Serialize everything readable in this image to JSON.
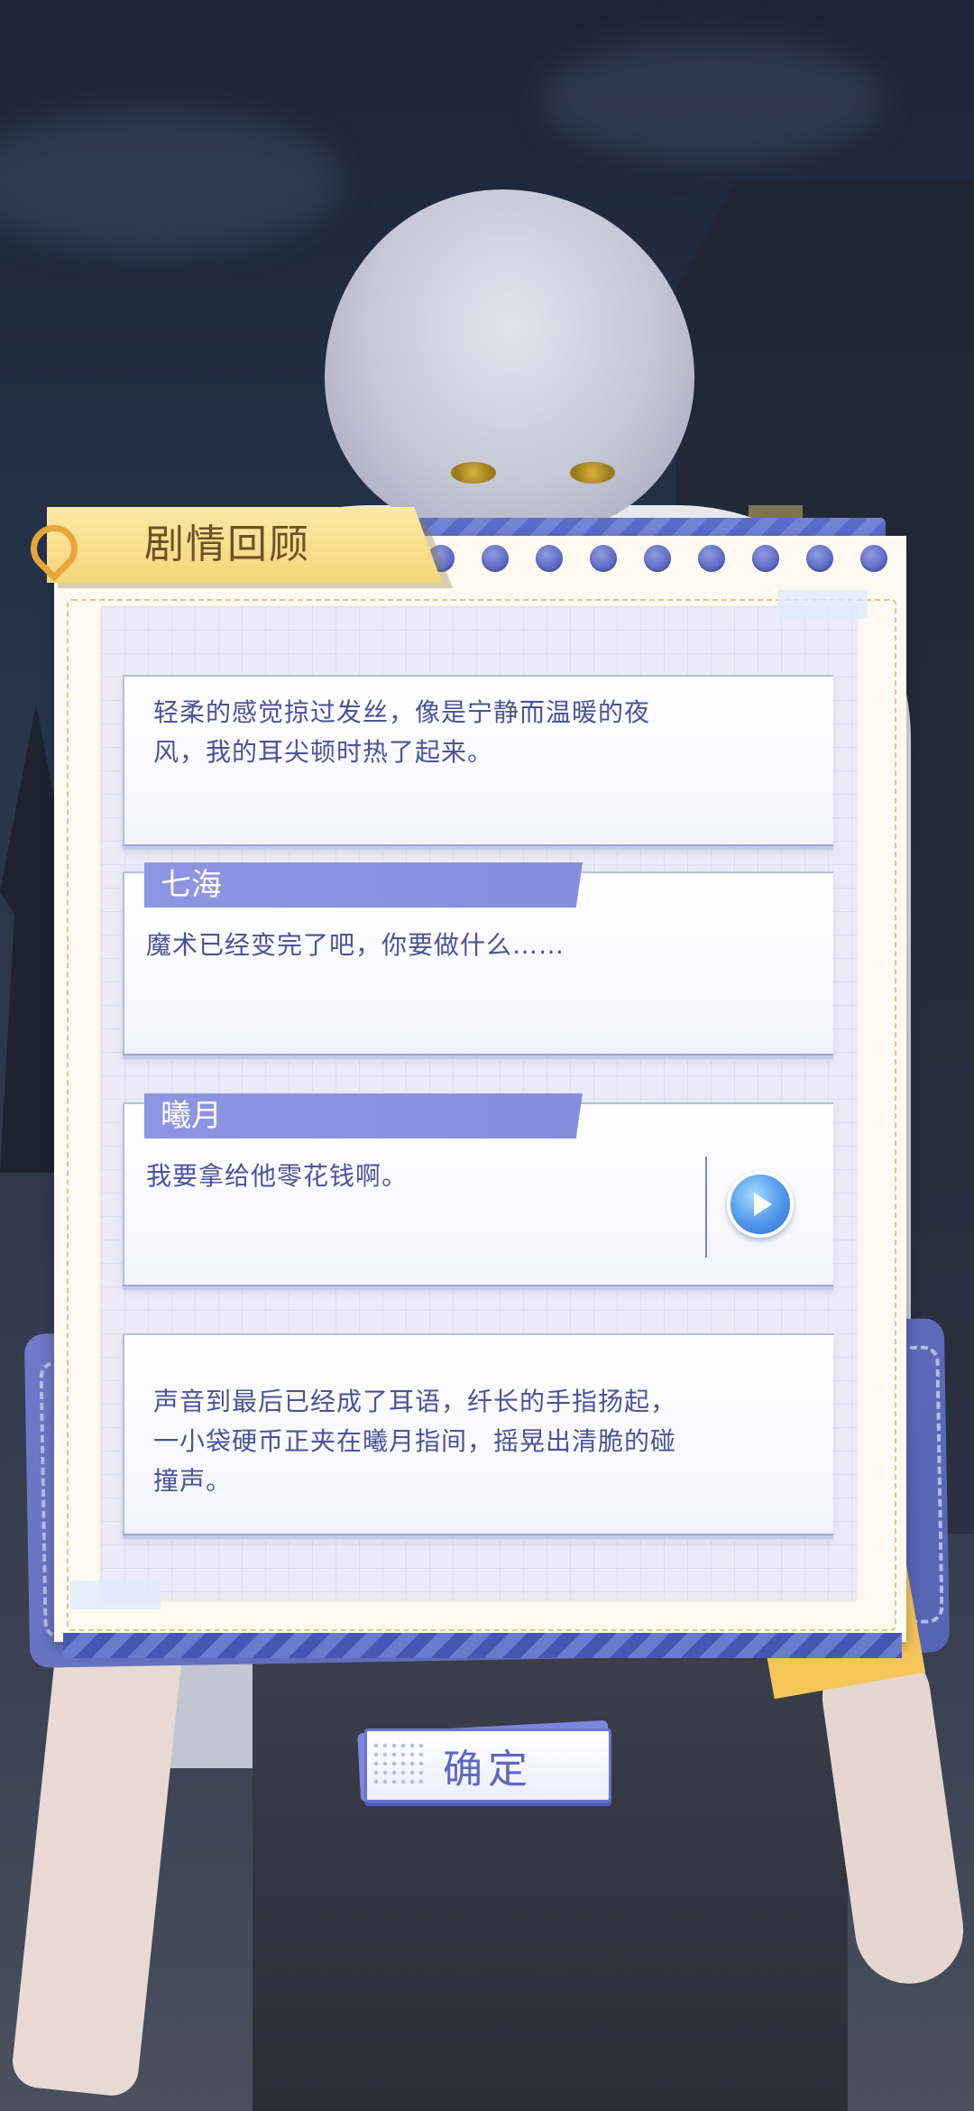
{
  "panel": {
    "title": "剧情回顾"
  },
  "dialogue": [
    {
      "speaker": "",
      "text": "轻柔的感觉掠过发丝，像是宁静而温暖的夜风，我的耳尖顿时热了起来。",
      "has_voice": false
    },
    {
      "speaker": "七海",
      "text": "魔术已经变完了吧，你要做什么……",
      "has_voice": false
    },
    {
      "speaker": "曦月",
      "text": "我要拿给他零花钱啊。",
      "has_voice": true,
      "voice_icon": "play-icon"
    },
    {
      "speaker": "",
      "text": "声音到最后已经成了耳语，纤长的手指扬起，一小袋硬币正夹在曦月指间，摇晃出清脆的碰撞声。",
      "has_voice": false
    }
  ],
  "confirm_button": {
    "label": "确定"
  },
  "colors": {
    "accent": "#858ddd",
    "text": "#4b5299",
    "banner": "#f4d77a",
    "stripe": "#5c6bc6"
  }
}
